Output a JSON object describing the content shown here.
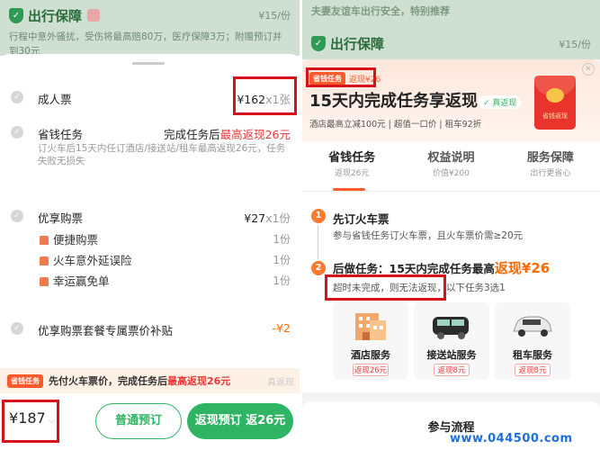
{
  "left": {
    "header": {
      "title": "出行保障",
      "price": "¥15/份",
      "desc": "行程中意外骚扰，受伤将最高赔80万，医疗保障3万；附赠预订并到30元"
    },
    "adult_ticket": {
      "label": "成人票",
      "price": "¥162",
      "qty": "x1张"
    },
    "savings_task": {
      "label": "省钱任务",
      "value_prefix": "完成任务后",
      "value_highlight": "最高返现26元",
      "desc": "订火车后15天内任订酒店/接送站/租车最高返现26元，任务失败无损失"
    },
    "preferred": {
      "label": "优享购票",
      "price": "¥27",
      "qty": "x1份",
      "items": [
        {
          "name": "便捷购票",
          "qty": "1份"
        },
        {
          "name": "火车意外延误险",
          "qty": "1份"
        },
        {
          "name": "幸运赢免单",
          "qty": "1份"
        }
      ]
    },
    "subsidy": {
      "label": "优享购票套餐专属票价补贴",
      "value": "-¥2"
    },
    "banner": {
      "badge": "省钱任务",
      "text_prefix": "先付火车票价，完成任务后",
      "text_highlight": "最高返现26元",
      "ghost": "真返现"
    },
    "bottom": {
      "total": "¥187",
      "normal_btn": "普通预订",
      "cashback_btn": "返现预订 返26元"
    }
  },
  "right": {
    "header": {
      "slogan": "夫妻友谊车出行安全，特别推荐",
      "title": "出行保障",
      "price": "¥15/份"
    },
    "promo": {
      "badge": "省钱任务",
      "amount": "返现¥26",
      "title": "15天内完成任务享返现",
      "pill": "真返现",
      "desc": "酒店最高立减100元 | 超值一口价 | 租车92折",
      "envelope_text": "省钱返现"
    },
    "tabs": [
      {
        "title": "省钱任务",
        "sub": "返现26元"
      },
      {
        "title": "权益说明",
        "sub": "价值¥200"
      },
      {
        "title": "服务保障",
        "sub": "出行更省心"
      }
    ],
    "steps": [
      {
        "no": "1",
        "title": "先订火车票",
        "desc": "参与省钱任务订火车票，且火车票价需≥20元"
      },
      {
        "no": "2",
        "title_prefix": "后做任务：15天内完成任务最高",
        "title_highlight": "返现¥26",
        "desc_boxed": "超时未完成，则无法返现，",
        "desc_rest": "以下任务3选1"
      }
    ],
    "services": [
      {
        "name": "酒店服务",
        "ret": "返现26元"
      },
      {
        "name": "接送站服务",
        "ret": "返现8元"
      },
      {
        "name": "租车服务",
        "ret": "返现8元"
      }
    ],
    "bottom_title": "参与流程",
    "watermark": "www.044500.com"
  }
}
